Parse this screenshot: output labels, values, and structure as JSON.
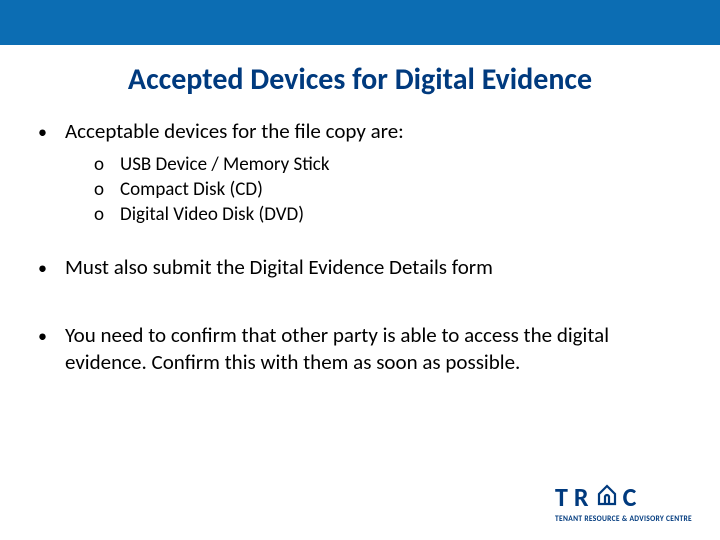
{
  "title": "Accepted Devices for Digital Evidence",
  "bullets": {
    "b1": {
      "marker": "•",
      "text": "Acceptable devices for the file copy are:"
    },
    "b2": {
      "marker": "•",
      "text": "Must also submit the Digital Evidence Details form"
    },
    "b3": {
      "marker": "•",
      "text": "You need to confirm that other party is able to access the digital evidence.  Confirm this with them as soon as possible."
    }
  },
  "sublist": {
    "marker": "o",
    "items": {
      "i1": "USB Device / Memory Stick",
      "i2": "Compact Disk (CD)",
      "i3": "Digital Video Disk (DVD)"
    }
  },
  "logo": {
    "letters": {
      "t": "T",
      "r": "R",
      "c": "C"
    },
    "subtitle": "TENANT RESOURCE & ADVISORY CENTRE"
  }
}
